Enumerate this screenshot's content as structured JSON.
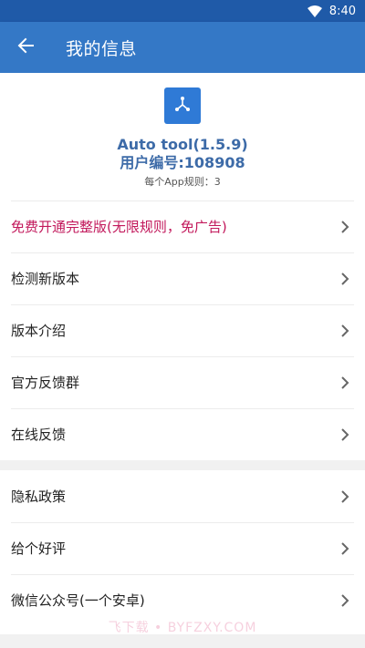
{
  "status_bar": {
    "time": "8:40",
    "wifi_icon": "wifi-icon",
    "battery_icon": "battery-icon"
  },
  "app_bar": {
    "back_icon": "arrow-left-icon",
    "title": "我的信息"
  },
  "header": {
    "icon": "share-nodes-icon",
    "icon_color": "#2f7ad6",
    "app_name": "Auto tool(1.5.9)",
    "user_id": "用户编号:108908",
    "rule_count": "每个App规则：3"
  },
  "menu_group_1": {
    "items": [
      {
        "label": "免费开通完整版(无限规则，免广告)",
        "highlight": true
      },
      {
        "label": "检测新版本"
      },
      {
        "label": "版本介绍"
      },
      {
        "label": "官方反馈群"
      },
      {
        "label": "在线反馈"
      }
    ]
  },
  "menu_group_2": {
    "items": [
      {
        "label": "隐私政策"
      },
      {
        "label": "给个好评"
      },
      {
        "label": "微信公众号(一个安卓)"
      }
    ]
  },
  "colors": {
    "app_bar": "#3478c6",
    "status_bar": "#1f5aa8",
    "accent_text": "#3d6ba8",
    "promo_text": "#c2185b"
  },
  "watermark": "飞下载 • BYFZXY.COM"
}
